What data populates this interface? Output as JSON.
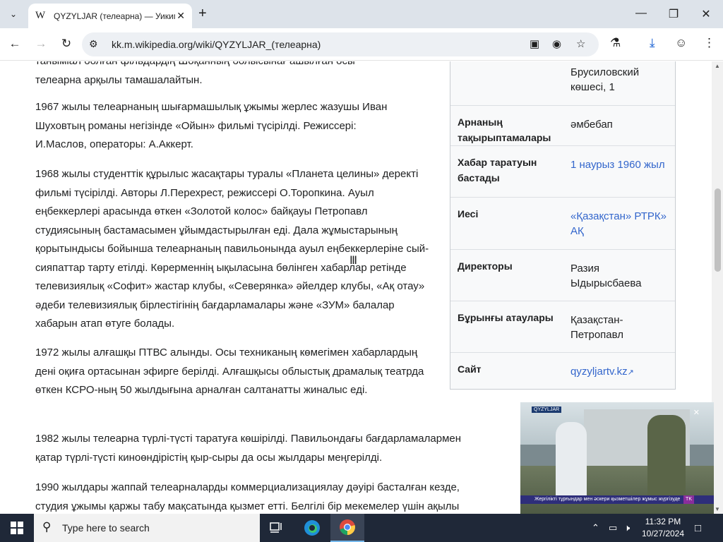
{
  "browser": {
    "tab_title": "QYZYLJAR (телеарна) — Уикипедия",
    "tab_favicon": "W",
    "url": "kk.m.wikipedia.org/wiki/QYZYLJAR_(телеарна)",
    "icons": {
      "tab_search": "chevron-down-icon",
      "close_tab": "close-icon",
      "new_tab": "plus-icon",
      "minimize": "minimize-icon",
      "maximize": "restore-icon",
      "close_window": "close-icon",
      "back": "back-arrow-icon",
      "forward": "forward-arrow-icon",
      "reload": "reload-icon",
      "site_info": "tune-icon",
      "install": "install-app-icon",
      "eye_off": "eye-off-icon",
      "bookmark": "star-icon",
      "labs": "flask-icon",
      "download": "download-icon",
      "profile": "profile-icon",
      "menu": "kebab-menu-icon"
    }
  },
  "article": {
    "top_line_partial": "таныміал болған фільдардің Шоқанның болысынағ ашылған осы",
    "p0_tail": "телеарна арқылы тамашалайтын.",
    "p1": "1967 жылы телеарнаның шығармашылық ұжымы жерлес жазушы Иван Шуховтың романы негізінде «Ойын» фильмі түсірілді. Режиссері: И.Маслов, операторы: А.Аккерт.",
    "p2": "1968 жылы студенттік құрылыс жасақтары туралы «Планета целины» деректі фильмі түсірілді. Авторы Л.Перехрест, режиссері О.Торопкина. Ауыл еңбеккерлері арасында өткен «Золотой колос» байқауы Петропавл студиясының бастамасымен ұйымдастырылған еді. Дала жұмыстарының қорытындысы бойынша телеарнаның павильонында ауыл еңбеккерлеріне сый-сияпаттар тарту етілді. Көрерменнің ықыласына бөлінген хабарлар ретінде телевизиялық «Софит» жастар клубы, «Северянка» әйелдер клубы, «Ақ отау» әдеби телевизиялық бірлестігінің бағдарламалары және «ЗУМ» балалар хабарын атап өтуге болады.",
    "p3": "1972 жылы алғашқы ПТВС алынды. Осы техниканың көмегімен хабарлардың дені оқиға ортасынан эфирге берілді. Алғашқысы облыстық драмалық театрда өткен КСРО-ның 50 жылдығына арналған салтанатты жиналыс еді.",
    "p4": "1982 жылы телеарна түрлі-түсті таратуға көшірілді. Павильондағы бағдарламалармен қатар түрлі-түсті киноөндірістің қыр-сыры да осы жылдары меңгерілді.",
    "p5": "1990 жылдары жаппай телеарналарды коммерциализациялау дәуірі басталған кезде, студия ұжымы қаржы табу мақсатында қызмет етті. Белгілі бір мекемелер үшін ақылы"
  },
  "infobox": {
    "address_line2": "Брусиловский",
    "address_line3": "көшесі, 1",
    "rows": [
      {
        "label": "Арнаның тақырыптамалары",
        "value": "әмбебап"
      },
      {
        "label": "Хабар таратуын бастады",
        "value": "1 наурыз 1960 жыл"
      },
      {
        "label": "Иесі",
        "value": "«Қазақстан» РТРК» АҚ"
      },
      {
        "label": "Директоры",
        "value": "Разия Ыдырысбаева"
      },
      {
        "label": "Бұрынғы атаулары",
        "value": "Қазақстан-Петропавл"
      },
      {
        "label": "Сайт",
        "value": "qyzyljartv.kz"
      }
    ]
  },
  "pip": {
    "tag": "QYZYLJAR",
    "ticker": "Жергілікті тұрғындар мен әскери қызметшілер жұмыс жүргізуде",
    "badge": "TK"
  },
  "taskbar": {
    "search_placeholder": "Type here to search",
    "time": "11:32 PM",
    "date": "10/27/2024",
    "icons": {
      "start": "windows-logo-icon",
      "search": "search-icon",
      "task_view": "task-view-icon",
      "edge": "edge-browser-icon",
      "chrome": "chrome-browser-icon",
      "tray_chevron": "chevron-up-icon",
      "network": "network-icon",
      "volume": "volume-muted-icon",
      "notifications": "notifications-icon"
    }
  }
}
